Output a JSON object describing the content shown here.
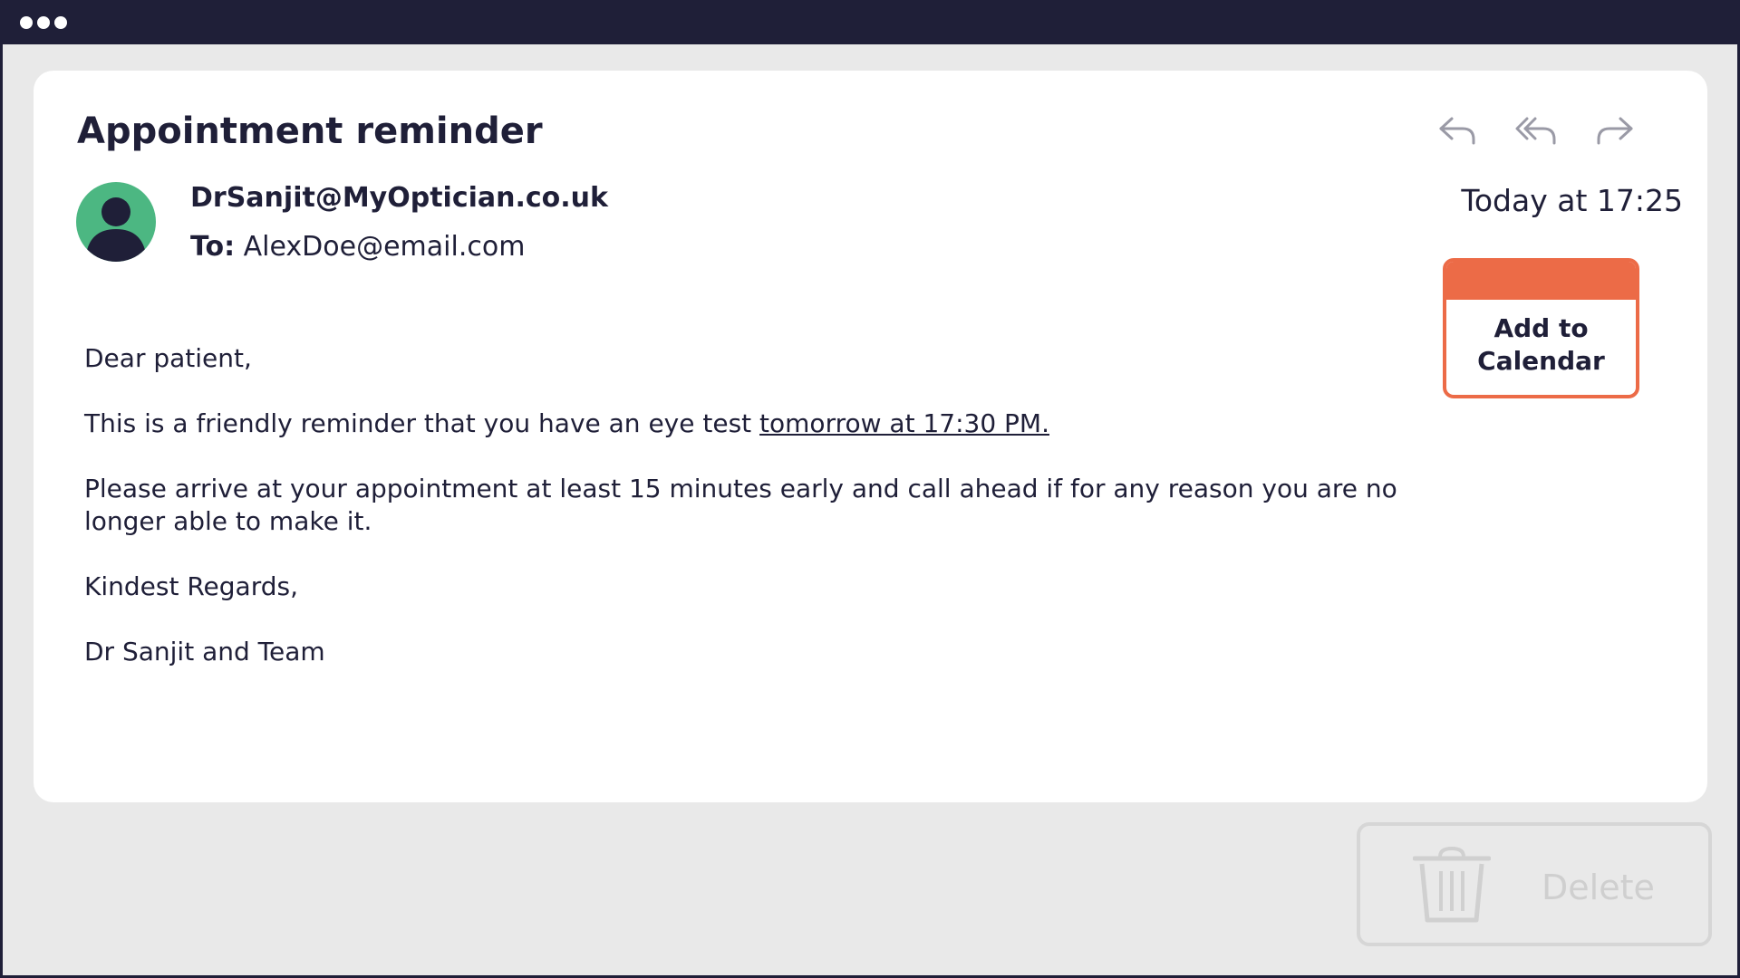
{
  "email": {
    "subject": "Appointment reminder",
    "sender": "DrSanjit@MyOptician.co.uk",
    "to_label": "To:",
    "to_address": "AlexDoe@email.com",
    "timestamp": "Today at 17:25",
    "body": {
      "greeting": "Dear patient,",
      "reminder_prefix": "This is a friendly reminder that you have an eye test ",
      "reminder_link": "tomorrow at 17:30 PM.",
      "instructions": "Please arrive at your appointment at least 15 minutes early and call ahead if for any reason you are no longer able to make it.",
      "closing": "Kindest Regards,",
      "signature": "Dr Sanjit and Team"
    }
  },
  "actions": {
    "reply_icon": "reply-icon",
    "reply_all_icon": "reply-all-icon",
    "forward_icon": "forward-icon"
  },
  "calendar_button": {
    "label_line1": "Add to",
    "label_line2": "Calendar"
  },
  "delete_button": {
    "label": "Delete",
    "icon": "trash-icon"
  },
  "colors": {
    "titlebar": "#1f1f38",
    "avatar": "#4cb782",
    "accent": "#ec6b47"
  }
}
